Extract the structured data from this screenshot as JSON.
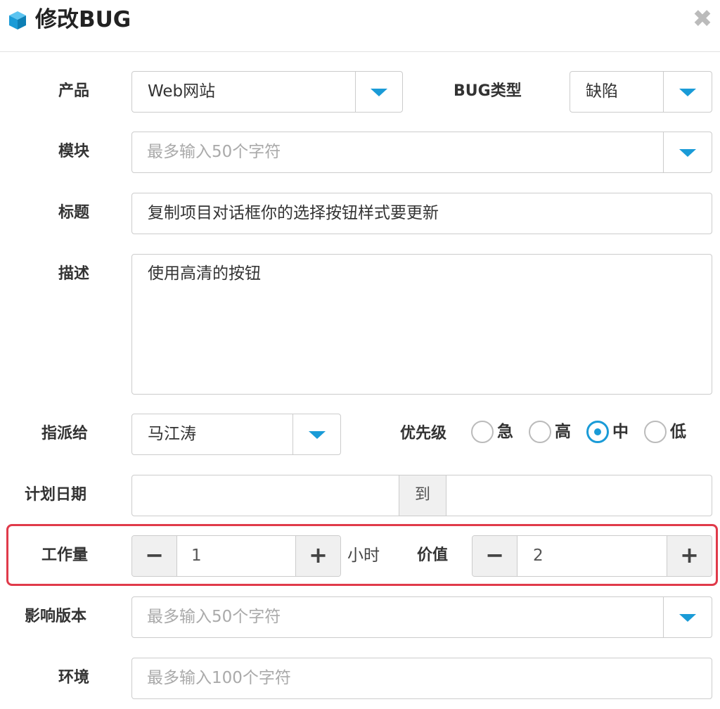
{
  "window": {
    "title": "修改BUG",
    "logo_icon": "cube-icon",
    "close_icon": "close-icon"
  },
  "form": {
    "product": {
      "label": "产品",
      "value": "Web网站"
    },
    "bug_type": {
      "label": "BUG类型",
      "value": "缺陷"
    },
    "module": {
      "label": "模块",
      "placeholder": "最多输入50个字符"
    },
    "title": {
      "label": "标题",
      "value": "复制项目对话框你的选择按钮样式要更新"
    },
    "description": {
      "label": "描述",
      "value": "使用高清的按钮"
    },
    "assignee": {
      "label": "指派给",
      "value": "马江涛"
    },
    "priority": {
      "label": "优先级",
      "options": [
        "急",
        "高",
        "中",
        "低"
      ],
      "selected": "中"
    },
    "plan_date": {
      "label": "计划日期",
      "separator": "到"
    },
    "workload": {
      "label": "工作量",
      "value": "1",
      "unit": "小时",
      "minus": "−",
      "plus": "+"
    },
    "value_field": {
      "label": "价值",
      "value": "2",
      "minus": "−",
      "plus": "+"
    },
    "affected_version": {
      "label": "影响版本",
      "placeholder": "最多输入50个字符"
    },
    "environment": {
      "label": "环境",
      "placeholder": "最多输入100个字符"
    }
  },
  "colors": {
    "accent": "#1a9bd7",
    "highlight": "#e03a4a"
  }
}
